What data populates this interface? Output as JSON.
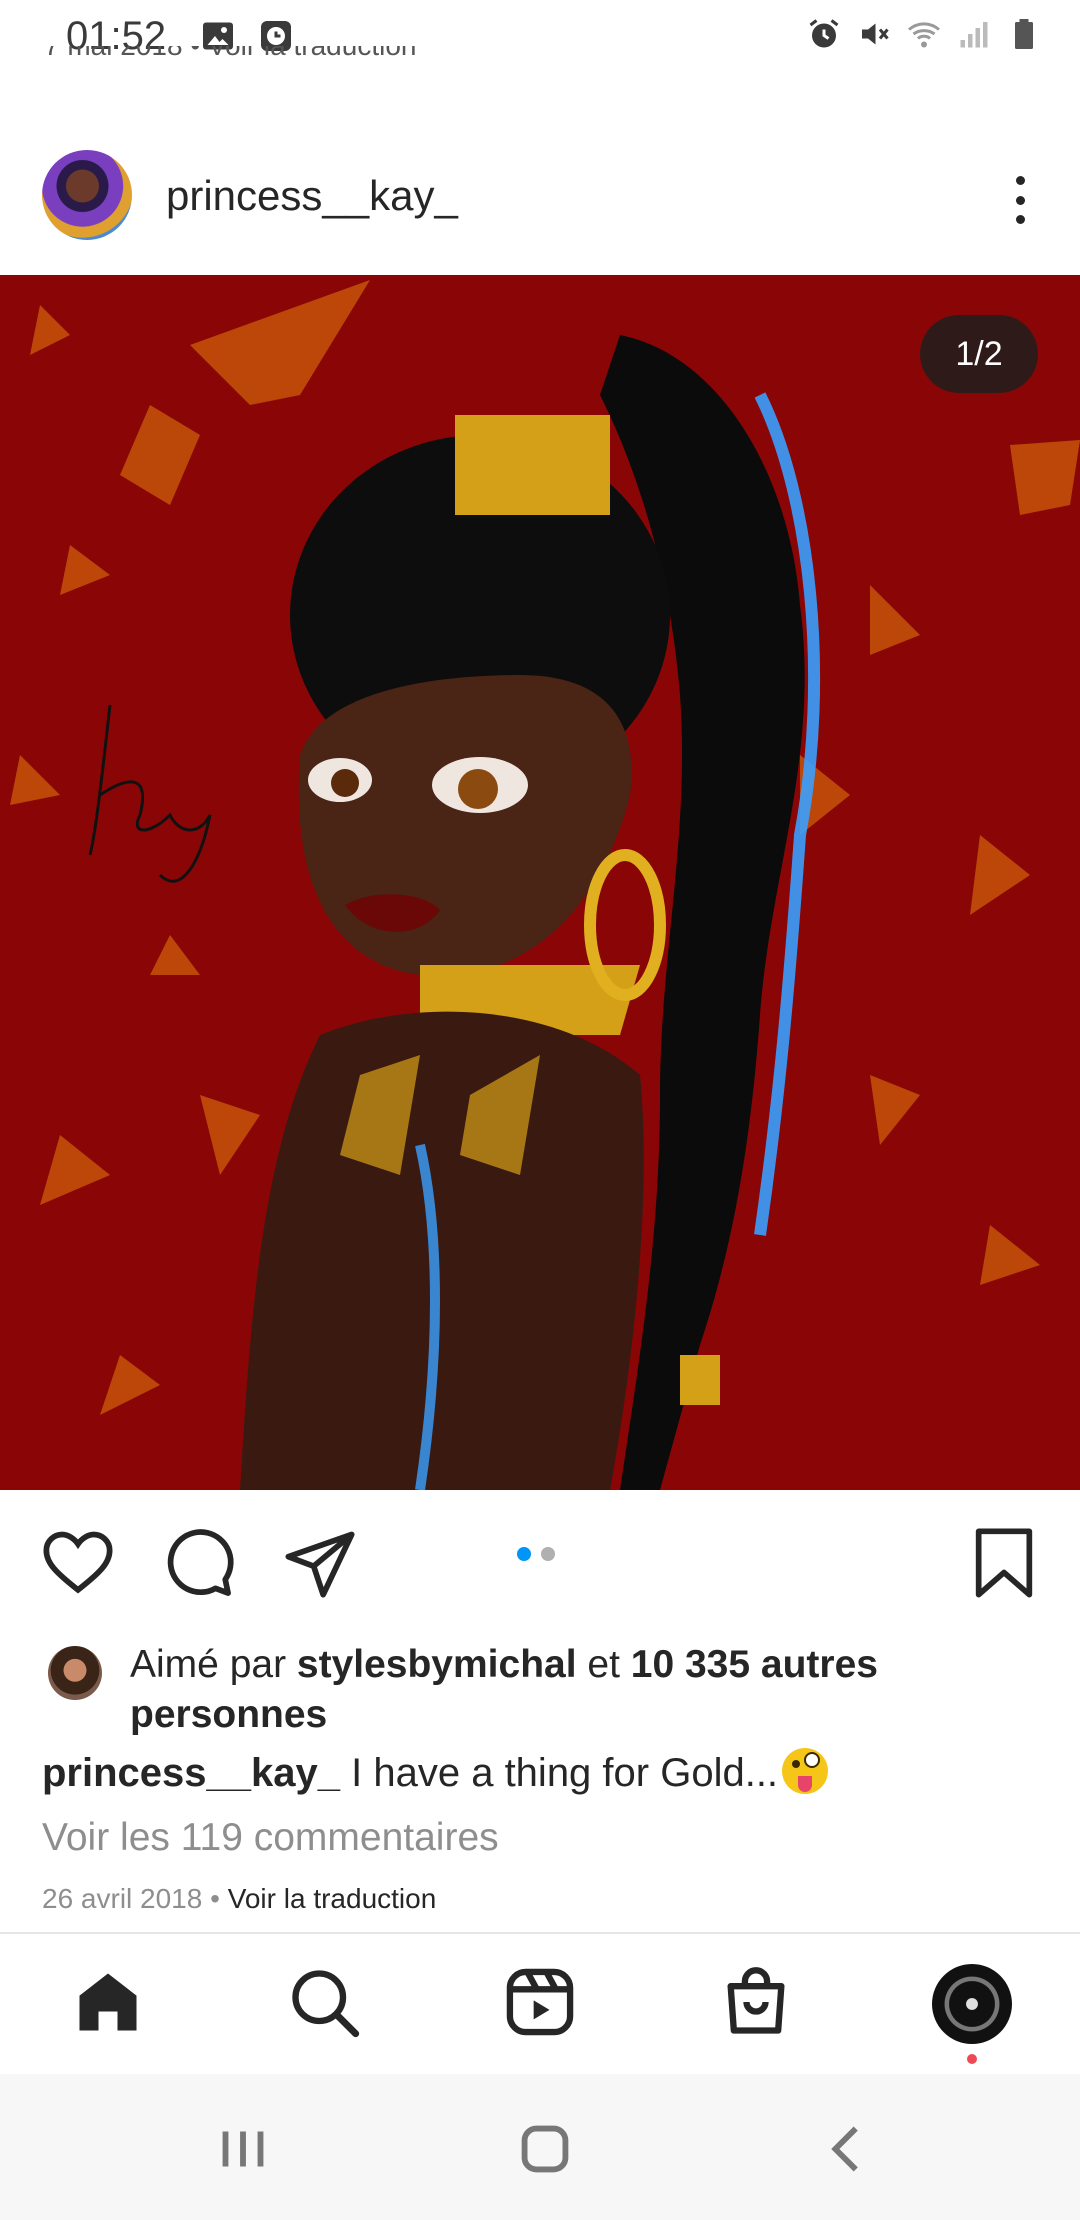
{
  "status_bar": {
    "time": "01:52",
    "left_icons": [
      "image-icon",
      "clock-app-icon"
    ],
    "right_icons": [
      "alarm-icon",
      "mute-icon",
      "wifi-icon",
      "signal-icon",
      "battery-icon"
    ]
  },
  "previous_post": {
    "clipped_text": "7 mai 2018 • Voir la traduction"
  },
  "post": {
    "username": "princess__kay_",
    "image_counter": "1/2",
    "image_description_icon": "illustration",
    "carousel": {
      "count": 2,
      "active": 1
    },
    "likes": {
      "prefix": "Aimé par ",
      "liker": "stylesbymichal",
      "middle": " et ",
      "others": "10 335 autres personnes"
    },
    "caption": {
      "username": "princess__kay_",
      "text": " I have a thing for Gold...",
      "emoji": "zany-face-emoji"
    },
    "comments_link": "Voir les 119 commentaires",
    "date": "26 avril 2018",
    "separator": " • ",
    "translate_link": "Voir la traduction"
  },
  "bottom_nav": [
    "home-icon",
    "search-icon",
    "reels-icon",
    "shop-icon",
    "profile-avatar"
  ],
  "system_nav": [
    "recents-icon",
    "home-button-icon",
    "back-icon"
  ],
  "colors": {
    "image_background": "#8a0606",
    "accent_blue": "#0095f6",
    "notification_red": "#ed4956",
    "text_primary": "#262626",
    "text_secondary": "#8e8e8e"
  }
}
